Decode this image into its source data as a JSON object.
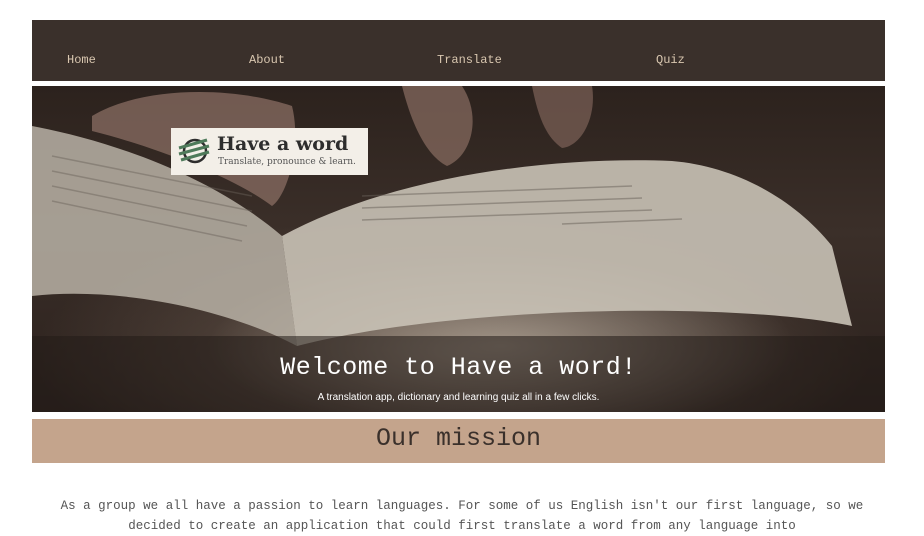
{
  "nav": {
    "items": [
      {
        "label": "Home"
      },
      {
        "label": "About"
      },
      {
        "label": "Translate"
      },
      {
        "label": "Quiz"
      }
    ]
  },
  "logo": {
    "title": "Have a word",
    "tagline": "Translate, pronounce & learn."
  },
  "hero": {
    "title": "Welcome to Have a word!",
    "subtitle": "A translation app, dictionary and learning quiz all in a few clicks."
  },
  "mission": {
    "title": "Our mission",
    "text": "As a group we all have a passion to learn languages. For some of us English isn't our first language, so we decided to create an application that could first translate a word from any language into"
  },
  "colors": {
    "nav_bg": "#3a302b",
    "nav_text": "#d9c7b0",
    "mission_bg": "#c4a48c"
  }
}
